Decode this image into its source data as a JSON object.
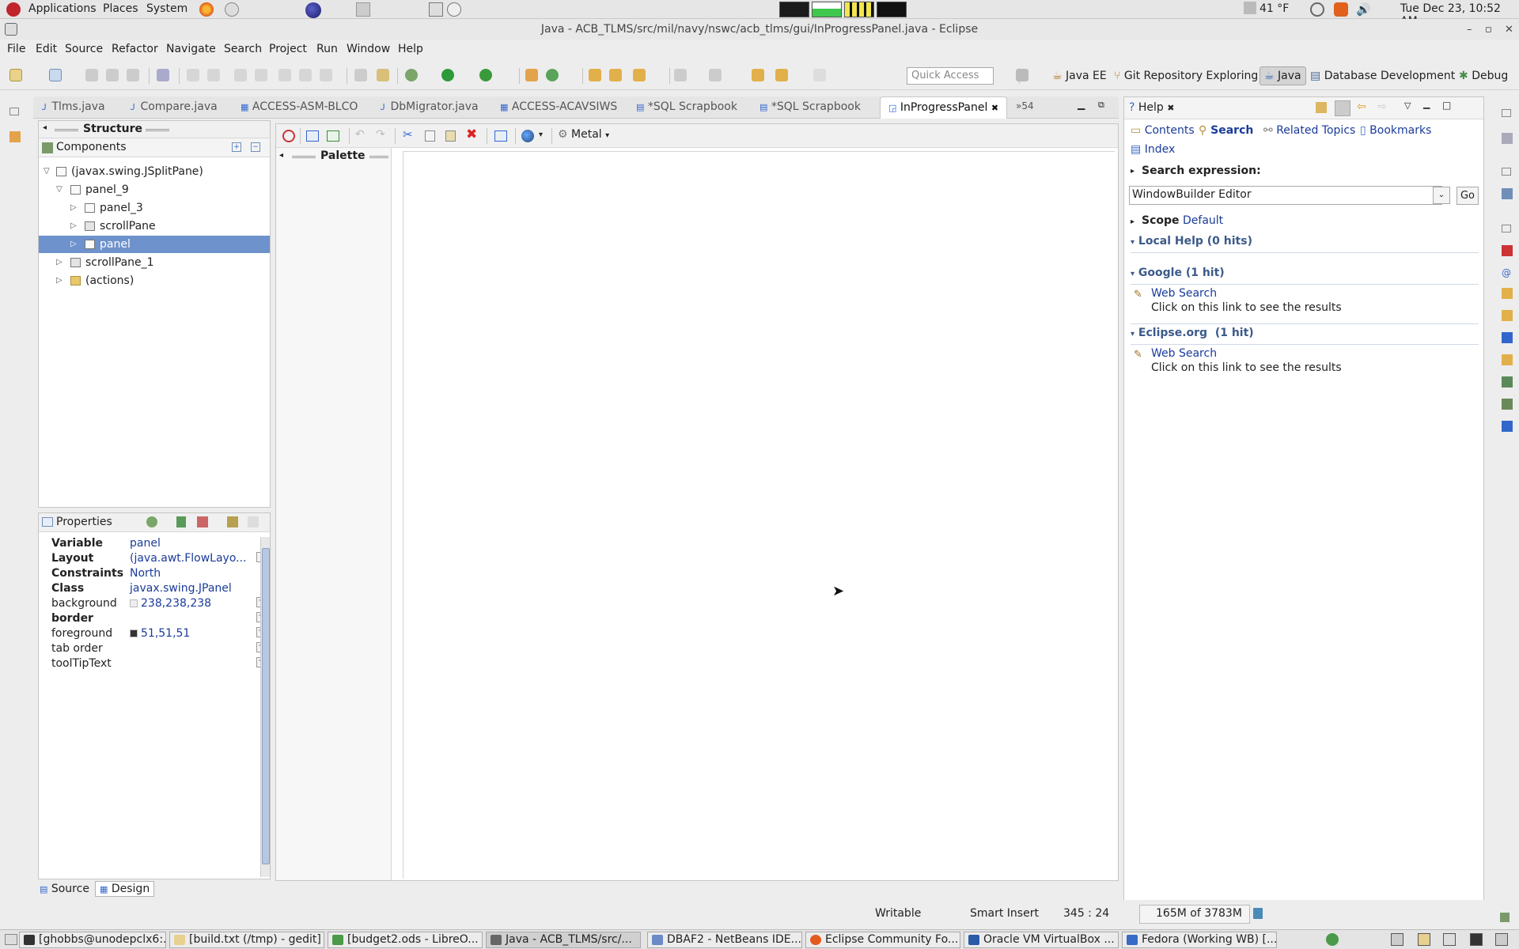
{
  "top_panel": {
    "menus": [
      "Applications",
      "Places",
      "System"
    ],
    "temperature": "41 °F",
    "clock": "Tue Dec 23, 10:52 AM"
  },
  "window": {
    "title": "Java - ACB_TLMS/src/mil/navy/nswc/acb_tlms/gui/InProgressPanel.java - Eclipse"
  },
  "menubar": [
    "File",
    "Edit",
    "Source",
    "Refactor",
    "Navigate",
    "Search",
    "Project",
    "Run",
    "Window",
    "Help"
  ],
  "toolbar": {
    "quick_access_placeholder": "Quick Access",
    "perspectives": [
      "Java EE",
      "Git Repository Exploring",
      "Java",
      "Database Development",
      "Debug"
    ]
  },
  "editor_tabs": [
    "Tlms.java",
    "Compare.java",
    "ACCESS-ASM-BLCO",
    "DbMigrator.java",
    "ACCESS-ACAVSIWS",
    "*SQL Scrapbook",
    "*SQL Scrapbook",
    "InProgressPanel",
    "»54"
  ],
  "structure": {
    "title": "Structure",
    "components_label": "Components",
    "tree": [
      {
        "label": "(javax.swing.JSplitPane)"
      },
      {
        "label": "panel_9"
      },
      {
        "label": "panel_3"
      },
      {
        "label": "scrollPane"
      },
      {
        "label": "panel"
      },
      {
        "label": "scrollPane_1"
      },
      {
        "label": "(actions)"
      }
    ]
  },
  "properties": {
    "title": "Properties",
    "rows": [
      {
        "name": "Variable",
        "value": "panel"
      },
      {
        "name": "Layout",
        "value": "(java.awt.FlowLayo..."
      },
      {
        "name": "Constraints",
        "value": "North"
      },
      {
        "name": "Class",
        "value": "javax.swing.JPanel"
      },
      {
        "name": "background",
        "value": "238,238,238"
      },
      {
        "name": "border",
        "value": ""
      },
      {
        "name": "foreground",
        "value": "51,51,51"
      },
      {
        "name": "tab order",
        "value": ""
      },
      {
        "name": "toolTipText",
        "value": ""
      }
    ]
  },
  "bottom_tabs": [
    "Source",
    "Design"
  ],
  "designer": {
    "palette_label": "Palette",
    "look_and_feel": "Metal"
  },
  "help": {
    "tab_label": "Help",
    "nav": [
      "Contents",
      "Search",
      "Related Topics",
      "Bookmarks",
      "Index"
    ],
    "search_expression_label": "Search expression:",
    "search_value": "WindowBuilder Editor",
    "go_label": "Go",
    "scope_label": "Scope",
    "scope_value": "Default",
    "sections": [
      {
        "title": "Local Help (0 hits)"
      },
      {
        "title": "Google (1 hit)",
        "link": "Web Search",
        "desc": "Click on this link to see the results"
      },
      {
        "title": "Eclipse.org  (1 hit)",
        "link": "Web Search",
        "desc": "Click on this link to see the results"
      }
    ]
  },
  "statusbar": {
    "writable": "Writable",
    "insert_mode": "Smart Insert",
    "position": "345 : 24",
    "heap": "165M of 3783M"
  },
  "taskbar": [
    "[ghobbs@unodepclx6:...",
    "[build.txt (/tmp) - gedit]",
    "[budget2.ods - LibreO...",
    "Java - ACB_TLMS/src/...",
    "DBAF2 - NetBeans IDE...",
    "Eclipse Community Fo...",
    "Oracle VM VirtualBox ...",
    "Fedora (Working WB) [..."
  ]
}
